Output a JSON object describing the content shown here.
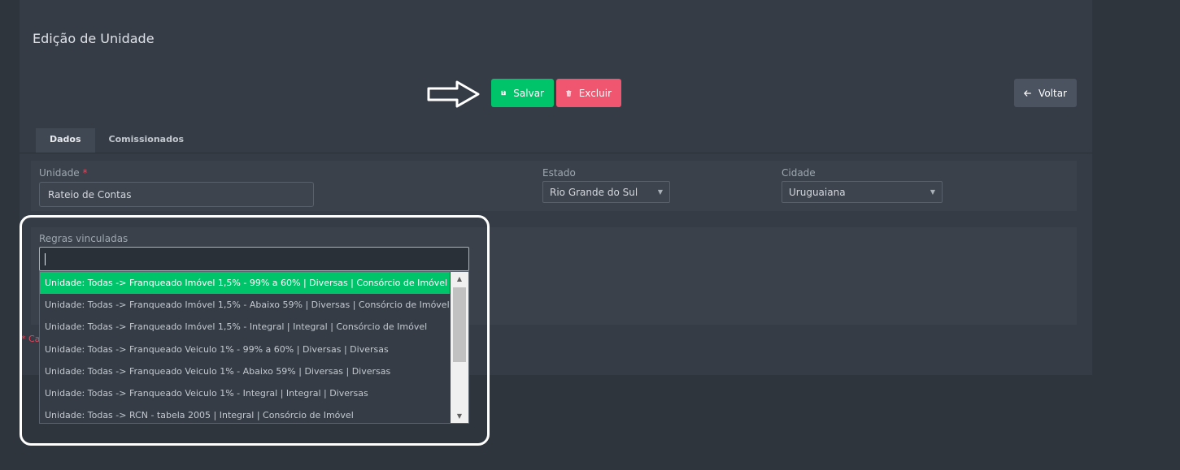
{
  "page": {
    "title": "Edição de Unidade"
  },
  "toolbar": {
    "save_label": "Salvar",
    "delete_label": "Excluir",
    "back_label": "Voltar"
  },
  "tabs": [
    {
      "label": "Dados"
    },
    {
      "label": "Comissionados"
    }
  ],
  "form": {
    "unidade": {
      "label": "Unidade",
      "required_mark": "*",
      "value": "Rateio de Contas"
    },
    "estado": {
      "label": "Estado",
      "value": "Rio Grande do Sul"
    },
    "cidade": {
      "label": "Cidade",
      "value": "Uruguaiana"
    },
    "regras": {
      "label": "Regras vinculadas",
      "search_value": ""
    },
    "required_note": "* Ca"
  },
  "dropdown": {
    "options": [
      "Unidade: Todas -> Franqueado Imóvel 1,5% - 99% a 60% | Diversas | Consórcio de Imóvel",
      "Unidade: Todas -> Franqueado Imóvel 1,5% - Abaixo 59% | Diversas | Consórcio de Imóvel",
      "Unidade: Todas -> Franqueado Imóvel 1,5% - Integral | Integral | Consórcio de Imóvel",
      "Unidade: Todas -> Franqueado Veiculo 1% - 99% a 60% | Diversas | Diversas",
      "Unidade: Todas -> Franqueado Veiculo 1% - Abaixo 59% | Diversas | Diversas",
      "Unidade: Todas -> Franqueado Veiculo 1% - Integral | Integral | Diversas",
      "Unidade: Todas -> RCN - tabela 2005 | Integral | Consórcio de Imóvel"
    ],
    "highlighted_index": 0
  },
  "colors": {
    "success": "#00c46a",
    "danger": "#f0566f",
    "secondary": "#4b5361"
  },
  "icons": {
    "save": "floppy-disk-icon",
    "delete": "trash-icon",
    "back": "arrow-left-icon"
  }
}
